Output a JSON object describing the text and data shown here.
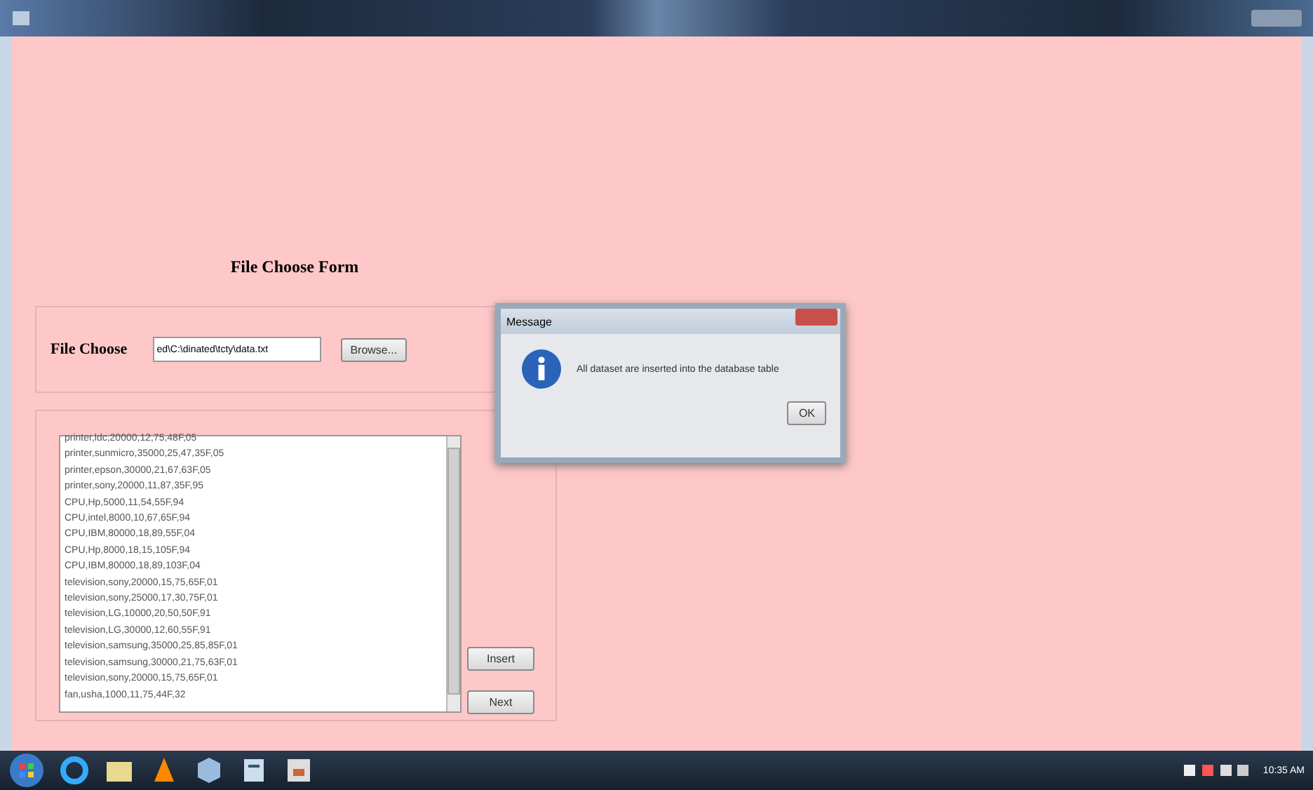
{
  "form": {
    "heading": "File Choose Form",
    "file_label": "File Choose",
    "file_path": "ed\\C:\\dinated\\tcty\\data.txt",
    "browse_button": "Browse...",
    "records": [
      "printer,ldc,20000,12,75,48F,05",
      "printer,sunmicro,35000,25,47,35F,05",
      "printer,epson,30000,21,67,63F,05",
      "printer,sony,20000,11,87,35F,95",
      "CPU,Hp,5000,11,54,55F,94",
      "CPU,intel,8000,10,67,65F,94",
      "CPU,IBM,80000,18,89,55F,04",
      "CPU,Hp,8000,18,15,105F,94",
      "CPU,IBM,80000,18,89,103F,04",
      "television,sony,20000,15,75,65F,01",
      "television,sony,25000,17,30,75F,01",
      "television,LG,10000,20,50,50F,91",
      "television,LG,30000,12,60,55F,91",
      "television,samsung,35000,25,85,85F,01",
      "television,samsung,30000,21,75,63F,01",
      "television,sony,20000,15,75,65F,01",
      "fan,usha,1000,11,75,44F,32"
    ],
    "buttons": [
      "Insert",
      "Next"
    ]
  },
  "dialog": {
    "title": "Message",
    "message": "All dataset are inserted into the database table",
    "ok_button": "OK"
  },
  "taskbar": {
    "clock": "10:35 AM"
  }
}
